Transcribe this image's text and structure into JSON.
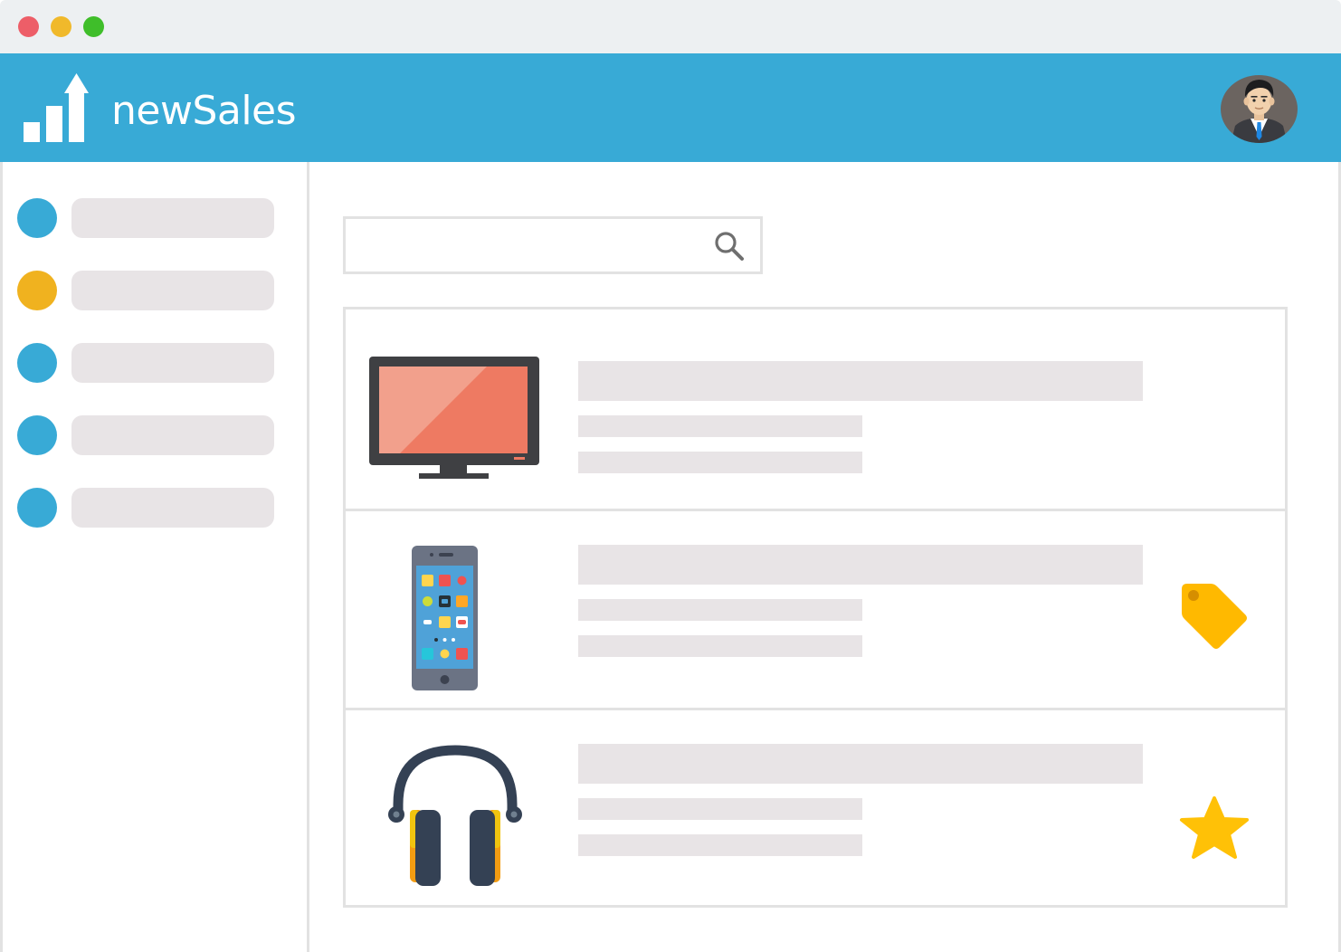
{
  "window": {
    "controls": [
      "close",
      "minimize",
      "maximize"
    ]
  },
  "header": {
    "brand": "newSales",
    "logo_icon": "bar-chart-arrow-up-icon",
    "avatar": "user-avatar-businessman"
  },
  "sidebar": {
    "items": [
      {
        "dot_color": "#38aad6",
        "label": ""
      },
      {
        "dot_color": "#f0b21f",
        "label": ""
      },
      {
        "dot_color": "#38aad6",
        "label": ""
      },
      {
        "dot_color": "#38aad6",
        "label": ""
      },
      {
        "dot_color": "#38aad6",
        "label": ""
      }
    ]
  },
  "search": {
    "value": "",
    "placeholder": "",
    "icon": "search-icon"
  },
  "products": [
    {
      "thumbnail": "tv-icon",
      "title": "",
      "line1": "",
      "line2": "",
      "badge": ""
    },
    {
      "thumbnail": "smartphone-icon",
      "title": "",
      "line1": "",
      "line2": "",
      "badge": "tag-icon"
    },
    {
      "thumbnail": "headphones-icon",
      "title": "",
      "line1": "",
      "line2": "",
      "badge": "star-icon"
    }
  ],
  "colors": {
    "header": "#38aad6",
    "titlebar": "#edf0f2",
    "placeholder": "#e8e4e6",
    "border": "#e2e2e2",
    "accent_orange": "#f0b21f",
    "accent_yellow": "#ffb900"
  }
}
